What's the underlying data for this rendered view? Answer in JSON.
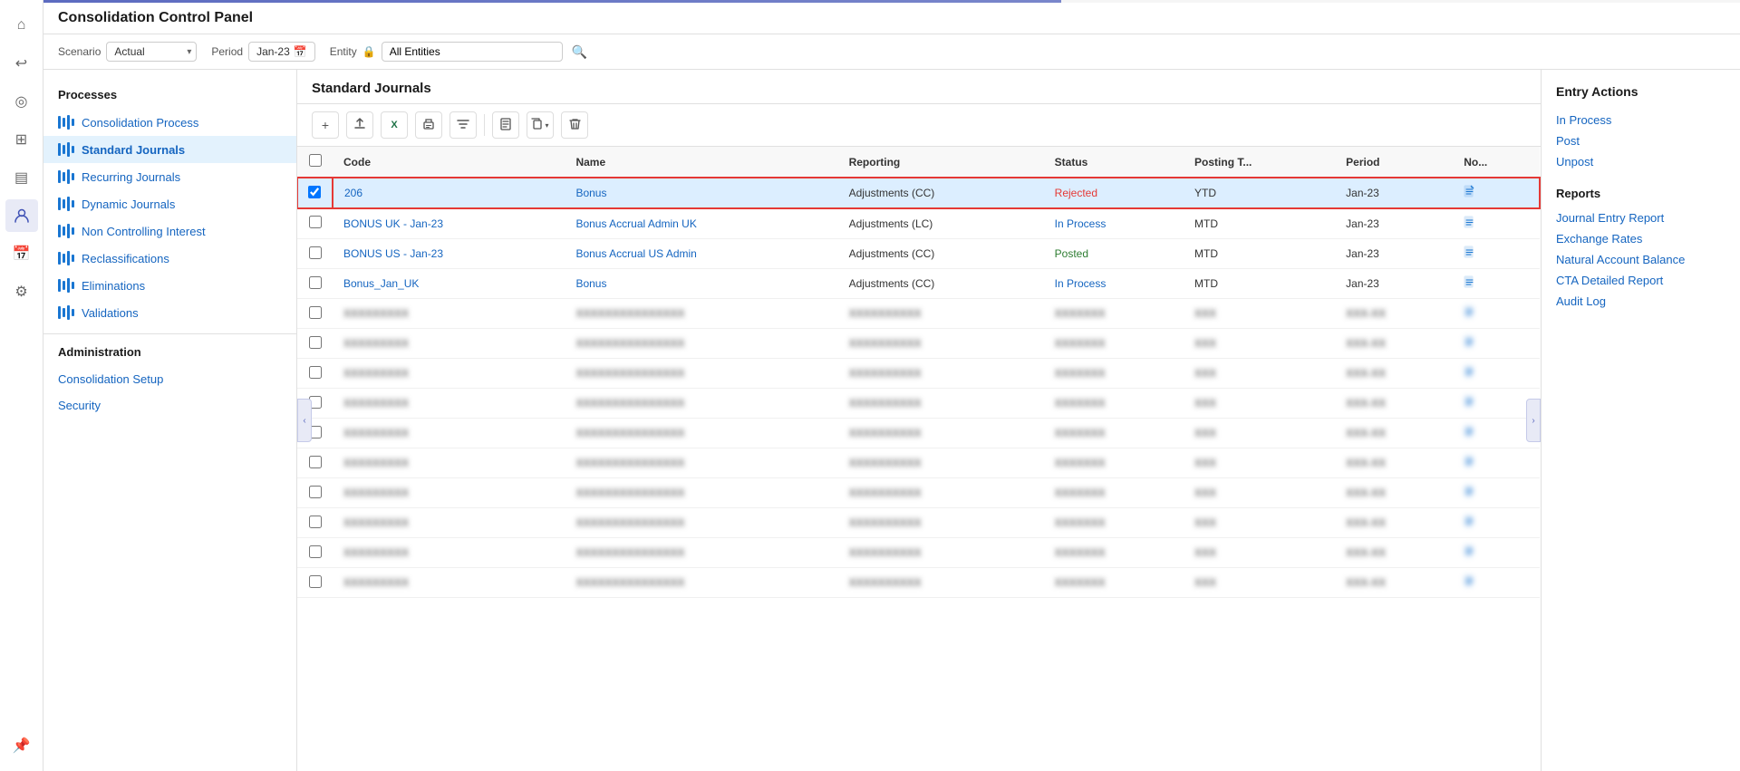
{
  "app": {
    "title": "Consolidation Control Panel",
    "progress_bar_width": "60%"
  },
  "filter_bar": {
    "scenario_label": "Scenario",
    "scenario_value": "Actual",
    "period_label": "Period",
    "period_value": "Jan-23",
    "entity_label": "Entity",
    "entity_value": "All Entities"
  },
  "icon_bar": {
    "items": [
      {
        "name": "home",
        "symbol": "⌂",
        "active": false
      },
      {
        "name": "back",
        "symbol": "↩",
        "active": false
      },
      {
        "name": "target",
        "symbol": "◎",
        "active": false
      },
      {
        "name": "grid",
        "symbol": "⊞",
        "active": false
      },
      {
        "name": "chart",
        "symbol": "▤",
        "active": false
      },
      {
        "name": "person",
        "symbol": "👤",
        "active": true
      },
      {
        "name": "calendar",
        "symbol": "📅",
        "active": false
      },
      {
        "name": "settings",
        "symbol": "⚙",
        "active": false
      }
    ],
    "pin_icon": "📌"
  },
  "sidebar": {
    "processes_title": "Processes",
    "administration_title": "Administration",
    "processes_items": [
      {
        "label": "Consolidation Process",
        "active": false
      },
      {
        "label": "Standard Journals",
        "active": true
      },
      {
        "label": "Recurring Journals",
        "active": false
      },
      {
        "label": "Dynamic Journals",
        "active": false
      },
      {
        "label": "Non Controlling Interest",
        "active": false
      },
      {
        "label": "Reclassifications",
        "active": false
      },
      {
        "label": "Eliminations",
        "active": false
      },
      {
        "label": "Validations",
        "active": false
      }
    ],
    "admin_items": [
      {
        "label": "Consolidation Setup",
        "active": false
      },
      {
        "label": "Security",
        "active": false
      }
    ]
  },
  "panel": {
    "title": "Standard Journals"
  },
  "toolbar": {
    "add_label": "+",
    "upload_label": "↑",
    "excel_label": "X",
    "print_label": "🖨",
    "filter_label": "▽",
    "doc_label": "📄",
    "copy_label": "⧉",
    "delete_label": "🗑"
  },
  "table": {
    "headers": [
      "",
      "Code",
      "Name",
      "Reporting",
      "Status",
      "Posting T...",
      "Period",
      "No..."
    ],
    "rows": [
      {
        "id": 1,
        "selected": true,
        "code": "206",
        "name": "Bonus",
        "reporting": "Adjustments (CC)",
        "status": "Rejected",
        "status_class": "status-rejected",
        "posting_type": "YTD",
        "period": "Jan-23",
        "blurred": false
      },
      {
        "id": 2,
        "selected": false,
        "code": "BONUS UK - Jan-23",
        "name": "Bonus Accrual Admin UK",
        "reporting": "Adjustments (LC)",
        "status": "In Process",
        "status_class": "status-inprocess",
        "posting_type": "MTD",
        "period": "Jan-23",
        "blurred": false
      },
      {
        "id": 3,
        "selected": false,
        "code": "BONUS US - Jan-23",
        "name": "Bonus Accrual US Admin",
        "reporting": "Adjustments (CC)",
        "status": "Posted",
        "status_class": "status-posted",
        "posting_type": "MTD",
        "period": "Jan-23",
        "blurred": false
      },
      {
        "id": 4,
        "selected": false,
        "code": "Bonus_Jan_UK",
        "name": "Bonus",
        "reporting": "Adjustments (CC)",
        "status": "In Process",
        "status_class": "status-inprocess",
        "posting_type": "MTD",
        "period": "Jan-23",
        "blurred": false
      },
      {
        "id": 5,
        "selected": false,
        "code": "",
        "name": "",
        "reporting": "",
        "status": "",
        "status_class": "",
        "posting_type": "",
        "period": "",
        "blurred": true
      },
      {
        "id": 6,
        "selected": false,
        "code": "",
        "name": "",
        "reporting": "",
        "status": "",
        "status_class": "",
        "posting_type": "",
        "period": "",
        "blurred": true
      },
      {
        "id": 7,
        "selected": false,
        "code": "",
        "name": "",
        "reporting": "",
        "status": "",
        "status_class": "",
        "posting_type": "",
        "period": "",
        "blurred": true
      },
      {
        "id": 8,
        "selected": false,
        "code": "",
        "name": "",
        "reporting": "",
        "status": "",
        "status_class": "",
        "posting_type": "",
        "period": "",
        "blurred": true
      },
      {
        "id": 9,
        "selected": false,
        "code": "",
        "name": "",
        "reporting": "",
        "status": "",
        "status_class": "",
        "posting_type": "",
        "period": "",
        "blurred": true
      },
      {
        "id": 10,
        "selected": false,
        "code": "",
        "name": "",
        "reporting": "",
        "status": "",
        "status_class": "",
        "posting_type": "",
        "period": "",
        "blurred": true
      },
      {
        "id": 11,
        "selected": false,
        "code": "",
        "name": "",
        "reporting": "",
        "status": "",
        "status_class": "",
        "posting_type": "",
        "period": "",
        "blurred": true
      },
      {
        "id": 12,
        "selected": false,
        "code": "",
        "name": "",
        "reporting": "",
        "status": "",
        "status_class": "",
        "posting_type": "",
        "period": "",
        "blurred": true
      },
      {
        "id": 13,
        "selected": false,
        "code": "",
        "name": "",
        "reporting": "",
        "status": "",
        "status_class": "",
        "posting_type": "",
        "period": "",
        "blurred": true
      },
      {
        "id": 14,
        "selected": false,
        "code": "",
        "name": "",
        "reporting": "",
        "status": "",
        "status_class": "",
        "posting_type": "",
        "period": "",
        "blurred": true
      }
    ]
  },
  "right_panel": {
    "entry_actions_title": "Entry Actions",
    "entry_actions": [
      {
        "label": "In Process"
      },
      {
        "label": "Post"
      },
      {
        "label": "Unpost"
      }
    ],
    "reports_title": "Reports",
    "reports": [
      {
        "label": "Journal Entry Report"
      },
      {
        "label": "Exchange Rates"
      },
      {
        "label": "Natural Account Balance"
      },
      {
        "label": "CTA Detailed Report"
      },
      {
        "label": "Audit Log"
      }
    ]
  },
  "colors": {
    "accent": "#1565c0",
    "active_bg": "#e3f2fd",
    "selected_row_bg": "#dceeff",
    "selected_row_border": "#e53935"
  }
}
